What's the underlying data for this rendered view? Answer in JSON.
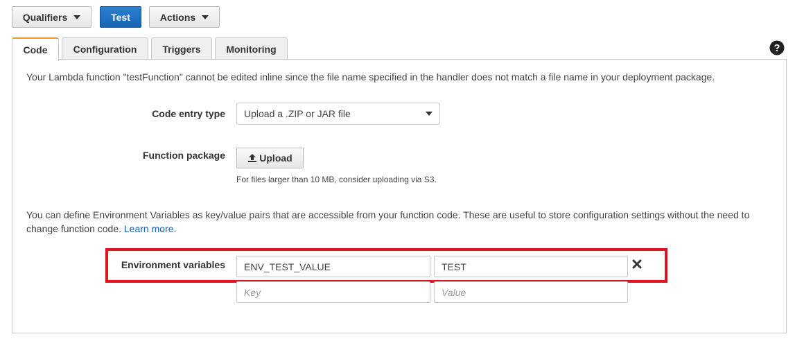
{
  "toolbar": {
    "qualifiers_label": "Qualifiers",
    "test_label": "Test",
    "actions_label": "Actions"
  },
  "tabs": [
    {
      "label": "Code",
      "active": true
    },
    {
      "label": "Configuration",
      "active": false
    },
    {
      "label": "Triggers",
      "active": false
    },
    {
      "label": "Monitoring",
      "active": false
    }
  ],
  "help_icon": "question-circle-icon",
  "code_panel": {
    "notice": "Your Lambda function \"testFunction\" cannot be edited inline since the file name specified in the handler does not match a file name in your deployment package.",
    "code_entry_type_label": "Code entry type",
    "code_entry_type_value": "Upload a .ZIP or JAR file",
    "function_package_label": "Function package",
    "upload_label": "Upload",
    "upload_icon": "upload-icon",
    "upload_hint": "For files larger than 10 MB, consider uploading via S3.",
    "env_description": "You can define Environment Variables as key/value pairs that are accessible from your function code. These are useful to store configuration settings without the need to change function code.",
    "learn_more": "Learn more.",
    "env_label": "Environment variables",
    "env_rows": [
      {
        "key": "ENV_TEST_VALUE",
        "value": "TEST"
      }
    ],
    "remove_icon": "close-icon",
    "new_row": {
      "key_placeholder": "Key",
      "value_placeholder": "Value"
    }
  },
  "colors": {
    "primary": "#1665b5",
    "active_tab_accent": "#e89b2b",
    "highlight_box": "#e0141e",
    "link": "#1a5fb4"
  }
}
